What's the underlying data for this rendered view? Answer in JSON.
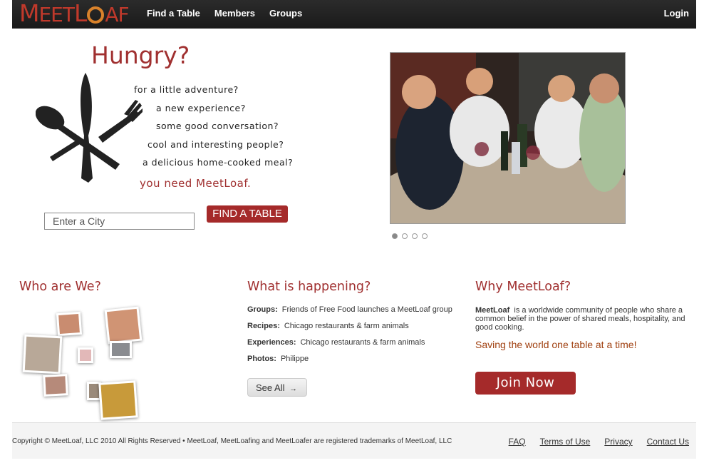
{
  "header": {
    "logo_text_left": "MEET",
    "logo_text_right": "LOAF",
    "nav": [
      "Find a Table",
      "Members",
      "Groups"
    ],
    "login": "Login"
  },
  "hero": {
    "title": "Hungry?",
    "questions": [
      "for a little adventure?",
      "a new experience?",
      "some good conversation?",
      "cool and interesting people?",
      "a delicious home-cooked meal?"
    ],
    "tagline": "you need MeetLoaf.",
    "city_placeholder": "Enter a City",
    "find_button": "FIND A TABLE",
    "carousel_pages": 4,
    "carousel_active": 1
  },
  "who": {
    "title": "Who are We?"
  },
  "happening": {
    "title": "What is happening?",
    "items": [
      {
        "label": "Groups:",
        "text": "Friends of Free Food launches a MeetLoaf group"
      },
      {
        "label": "Recipes:",
        "text": "Chicago restaurants & farm animals"
      },
      {
        "label": "Experiences:",
        "text": "Chicago restaurants & farm animals"
      },
      {
        "label": "Photos:",
        "text": "Philippe"
      }
    ],
    "see_all": "See All"
  },
  "why": {
    "title": "Why MeetLoaf?",
    "brand": "MeetLoaf",
    "body": "is a worldwide community of people who share a common belief in the power of shared meals, hospitality, and good cooking.",
    "slogan": "Saving the world one table at a time!",
    "join_button": "Join Now"
  },
  "footer": {
    "copyright": "Copyright © MeetLoaf, LLC 2010 All Rights Reserved • MeetLoaf, MeetLoafing and MeetLoafer are registered trademarks of MeetLoaf, LLC",
    "links": [
      "FAQ",
      "Terms of Use",
      "Privacy",
      "Contact Us"
    ]
  },
  "colors": {
    "brand": "#a52a2a",
    "header_bg": "#1f1f1f",
    "accent_orange": "#d9822b"
  }
}
